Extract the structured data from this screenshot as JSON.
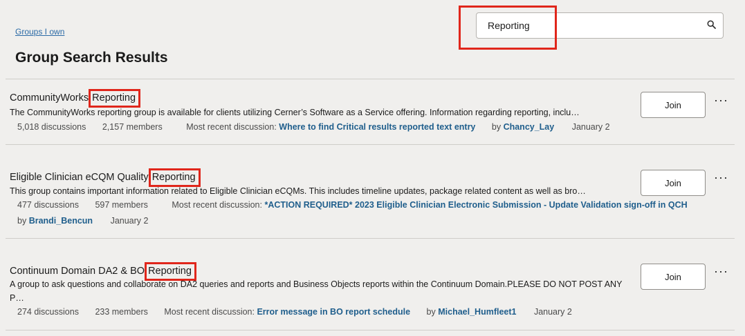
{
  "header": {
    "groups_link": "Groups I own",
    "title": "Group Search Results"
  },
  "search": {
    "value": "Reporting",
    "icon": "search-icon"
  },
  "results": [
    {
      "title_prefix": "CommunityWorks ",
      "title_highlight": "Reporting",
      "description": "The CommunityWorks reporting group is available for clients utilizing Cerner’s Software as a Service offering. Information regarding reporting, inclu…",
      "discussions": "5,018 discussions",
      "members": "2,157 members",
      "recent_label": "Most recent discussion:",
      "recent_title": "Where to find Critical results reported text entry",
      "by": "by",
      "author": "Chancy_Lay",
      "date": "January 2",
      "join_label": "Join",
      "more_label": "···"
    },
    {
      "title_prefix": "Eligible Clinician eCQM Quality ",
      "title_highlight": "Reporting",
      "description": "This group contains important information related to Eligible Clinician eCQMs. This includes timeline updates, package related content as well as bro…",
      "discussions": "477 discussions",
      "members": "597 members",
      "recent_label": "Most recent discussion:",
      "recent_title": "*ACTION REQUIRED* 2023 Eligible Clinician Electronic Submission - Update Validation sign-off in QCH",
      "by": "by",
      "author": "Brandi_Bencun",
      "date": "January 2",
      "join_label": "Join",
      "more_label": "···"
    },
    {
      "title_prefix": "Continuum Domain DA2 & BO ",
      "title_highlight": "Reporting",
      "description_line1": "A group to ask questions and collaborate on DA2 queries and reports and Business Objects reports within the Continuum Domain.PLEASE DO NOT POST ANY",
      "description_line2": "P…",
      "discussions": "274 discussions",
      "members": "233 members",
      "recent_label": "Most recent discussion:",
      "recent_title": "Error message in BO report schedule",
      "by": "by",
      "author": "Michael_Humfleet1",
      "date": "January 2",
      "join_label": "Join",
      "more_label": "···"
    }
  ],
  "colors": {
    "background": "#f0efed",
    "link": "#1f5e8c",
    "highlight_border": "#e0261b"
  }
}
